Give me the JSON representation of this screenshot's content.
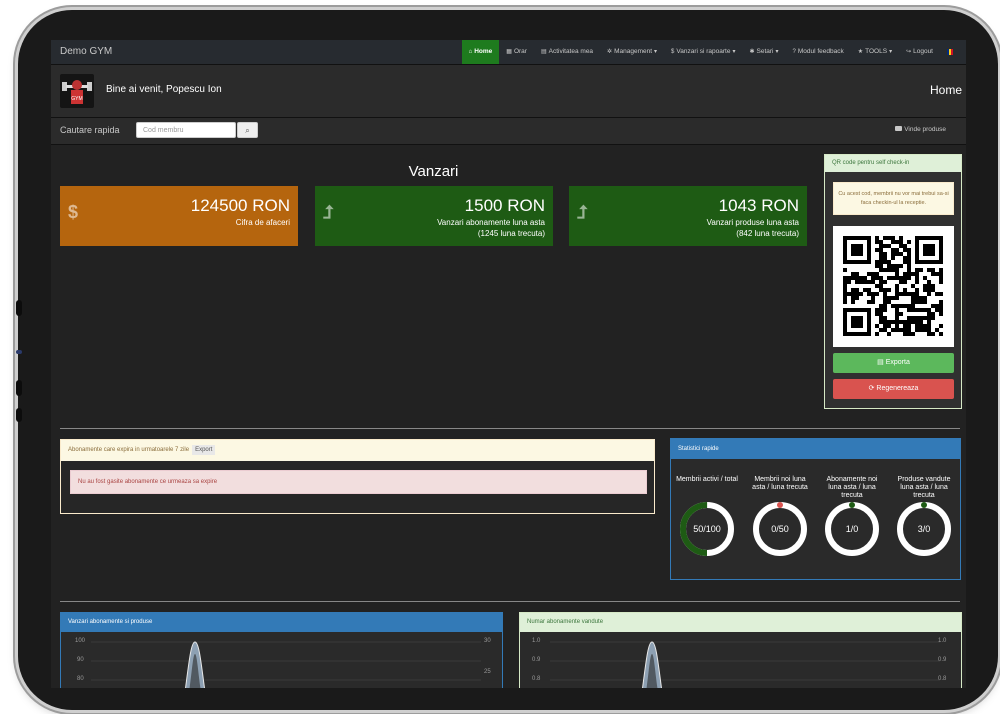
{
  "navbar": {
    "brand": "Demo GYM",
    "items": [
      {
        "icon": "home-icon",
        "glyph": "⌂",
        "label": "Home",
        "active": true
      },
      {
        "icon": "calendar-icon",
        "glyph": "▦",
        "label": "Orar"
      },
      {
        "icon": "list-icon",
        "glyph": "▤",
        "label": "Activitatea mea"
      },
      {
        "icon": "gears-icon",
        "glyph": "✲",
        "label": "Management",
        "dropdown": true
      },
      {
        "icon": "dollar-icon",
        "glyph": "$",
        "label": "Vanzari si rapoarte",
        "dropdown": true
      },
      {
        "icon": "gear-icon",
        "glyph": "✱",
        "label": "Setari",
        "dropdown": true
      },
      {
        "icon": "question-circle-icon",
        "glyph": "?",
        "label": "Modul feedback"
      },
      {
        "icon": "star-icon",
        "glyph": "★",
        "label": "TOOLS",
        "dropdown": true
      },
      {
        "icon": "logout-icon",
        "glyph": "↪",
        "label": "Logout"
      }
    ],
    "flag_colors": [
      "#002b7f",
      "#fcd116",
      "#ce1126"
    ]
  },
  "header": {
    "welcome": "Bine ai venit, Popescu Ion",
    "page_title": "Home"
  },
  "search": {
    "label": "Cautare rapida",
    "placeholder": "Cod membru",
    "sell_link": "Vinde produse"
  },
  "sales": {
    "title": "Vanzari",
    "cards": [
      {
        "value": "124500 RON",
        "label": "Cifra de afaceri",
        "sub": "",
        "color": "#b5650e",
        "icon": "dollar-icon",
        "glyph": "$"
      },
      {
        "value": "1500 RON",
        "label": "Vanzari abonamente luna asta",
        "sub": "(1245 luna trecuta)",
        "color": "#1e5b14",
        "icon": "level-up-icon",
        "glyph": "⮥"
      },
      {
        "value": "1043 RON",
        "label": "Vanzari produse luna asta",
        "sub": "(842 luna trecuta)",
        "color": "#1e5b14",
        "icon": "level-up-icon",
        "glyph": "⮥"
      }
    ]
  },
  "qr": {
    "title": "QR code pentru self check-in",
    "note": "Cu acest cod, membrii nu vor mai trebui sa-si faca checkin-ul la receptie.",
    "export_label": "Exporta",
    "regen_label": "Regenereaza"
  },
  "expiring": {
    "title": "Abonamente care expira in urmatoarele 7 zile",
    "export_label": "Export",
    "empty_message": "Nu au fost gasite abonamente ce urmeaza sa expire"
  },
  "stats": {
    "title": "Statistici rapide",
    "items": [
      {
        "label": "Membrii activi / total",
        "value": "50/100",
        "fraction": 0.5,
        "color": "#1e5b14"
      },
      {
        "label": "Membrii noi luna asta / luna trecuta",
        "value": "0/50",
        "fraction": 0.0,
        "color": "#d9534f"
      },
      {
        "label": "Abonamente noi luna asta / luna trecuta",
        "value": "1/0",
        "fraction": 0.0,
        "color": "#1e5b14"
      },
      {
        "label": "Produse vandute luna asta / luna trecuta",
        "value": "3/0",
        "fraction": 0.0,
        "color": "#1e5b14"
      }
    ]
  },
  "charts": {
    "sales_title": "Vanzari abonamente si produse",
    "sales_left_ticks": [
      "100",
      "90",
      "80"
    ],
    "sales_right_ticks": [
      "30",
      "25"
    ],
    "count_title": "Numar abonamente vandute",
    "count_left_ticks": [
      "1.0",
      "0.9",
      "0.8"
    ],
    "count_right_ticks": [
      "1.0",
      "0.9",
      "0.8"
    ]
  }
}
